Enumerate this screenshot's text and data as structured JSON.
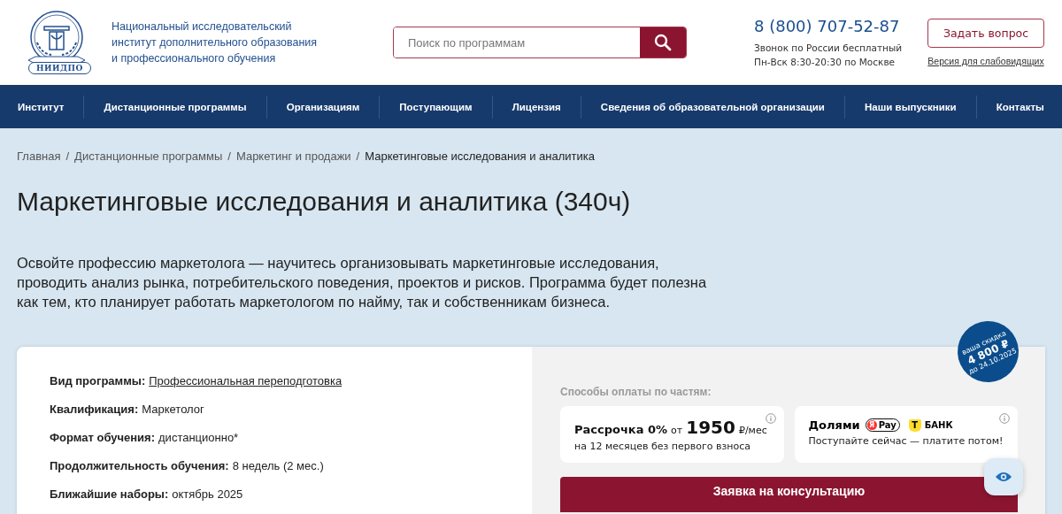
{
  "header": {
    "logo_caption": "НИИДПО",
    "org_name": [
      "Национальный исследовательский",
      "институт дополнительного образования",
      "и профессионального обучения"
    ],
    "search": {
      "placeholder": "Поиск по программам"
    },
    "phone": "8 (800) 707-52-87",
    "phone_notes": [
      "Звонок по России бесплатный",
      "Пн-Вск 8:30-20:30 по Москве"
    ],
    "ask_button": "Задать вопрос",
    "accessibility_link": "Версия для слабовидящих"
  },
  "nav": {
    "items": [
      {
        "label": "Институт"
      },
      {
        "label": "Дистанционные программы"
      },
      {
        "label": "Организациям"
      },
      {
        "label": "Поступающим"
      },
      {
        "label": "Лицензия"
      },
      {
        "label": "Сведения об образовательной организации"
      },
      {
        "label": "Наши выпускники"
      },
      {
        "label": "Контакты"
      }
    ]
  },
  "breadcrumb_separator": "/",
  "breadcrumbs": [
    {
      "label": "Главная",
      "current": false
    },
    {
      "label": "Дистанционные программы",
      "current": false
    },
    {
      "label": "Маркетинг и продажи",
      "current": false
    },
    {
      "label": "Маркетинговые исследования и аналитика",
      "current": true
    }
  ],
  "title": "Маркетинговые исследования и аналитика (340ч)",
  "description": "Освойте профессию маркетолога — научитесь организовывать маркетинговые исследования, проводить анализ рынка, потребительского поведения, проектов и рисков. Программа будет полезна как тем, кто планирует работать маркетологом по найму, так и собственникам бизнеса.",
  "details": [
    {
      "label": "Вид программы:",
      "value": "Профессиональная переподготовка",
      "kind": "link"
    },
    {
      "label": "Квалификация:",
      "value": "Маркетолог",
      "kind": "text"
    },
    {
      "label": "Формат обучения:",
      "value": "дистанционно*",
      "kind": "text"
    },
    {
      "label": "Продолжительность обучения:",
      "value": "8 недель (2 мес.)",
      "kind": "text"
    },
    {
      "label": "Ближайшие наборы:",
      "value": "октябрь 2025",
      "kind": "text"
    }
  ],
  "discount_badge": {
    "caption": "ваша скидка",
    "amount": "4 800 ₽",
    "until": "до 24.10.2025"
  },
  "payment": {
    "heading": "Способы оплаты по частям:",
    "installment": {
      "title": "Рассрочка 0%",
      "from": "от",
      "price": "1950",
      "unit": "₽/мес",
      "note": "на 12 месяцев без первого взноса"
    },
    "dolyami": {
      "title": "Долями",
      "pay_mark": "Я",
      "pay_label": "Pay",
      "bank_mark": "Т",
      "bank_label": "БАНК",
      "note": "Поступайте сейчас — платите потом!"
    }
  },
  "consult_button": "Заявка на консультацию"
}
